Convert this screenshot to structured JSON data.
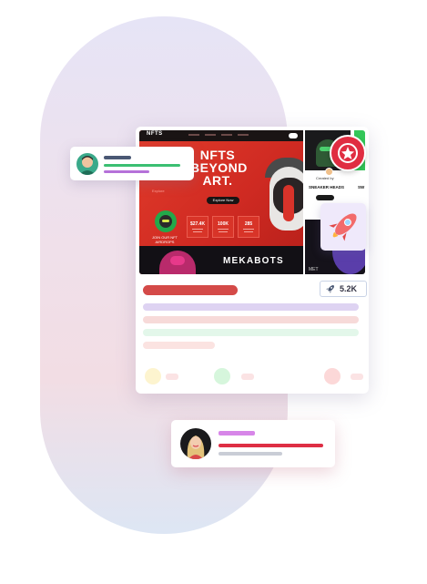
{
  "colors": {
    "brand_red": "#d44a48",
    "purple_line": "#ded3f2",
    "pink_line": "#f7dad9",
    "mint_line": "#e3f7ea",
    "rose_line": "#fbe3e1"
  },
  "preview": {
    "logo": "NFTS",
    "hero_title": "NFTS BEYOND ART.",
    "hero_button": "Explore Now",
    "explore_label": "Explore",
    "join_text": "JOIN OUR NFT AIRDROPS",
    "stats": [
      {
        "value": "$27.4K"
      },
      {
        "value": "100K"
      },
      {
        "value": "285"
      }
    ],
    "collection_name": "MEKABOTS",
    "side_created": "Created by",
    "side_title": "SNEAKER HEADS",
    "side_title_cut": "SW",
    "side_bottom": "MET"
  },
  "post": {
    "likes": "5.2K",
    "likes_icon": "rocket-icon",
    "badge_icon": "star-icon",
    "sticker_icon": "rocket-icon"
  }
}
